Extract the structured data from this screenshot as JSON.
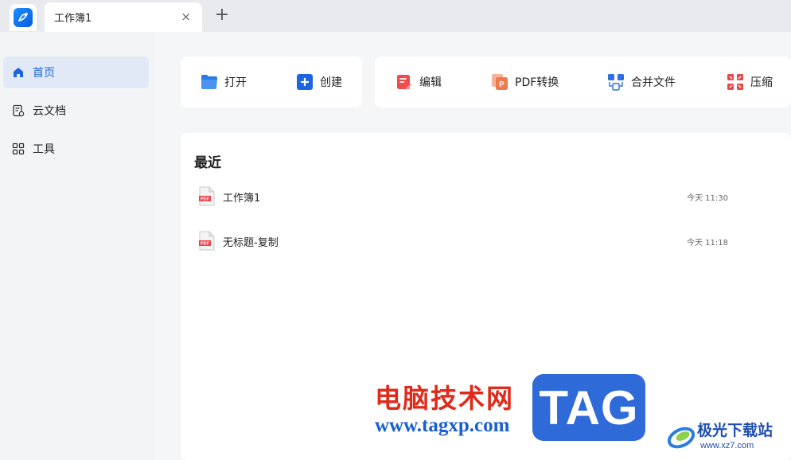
{
  "tabbar": {
    "tab_title": "工作簿1",
    "close_symbol": "×",
    "new_tab_symbol": "+"
  },
  "sidebar": {
    "items": [
      {
        "label": "首页",
        "icon": "home-icon",
        "active": true
      },
      {
        "label": "云文档",
        "icon": "cloud-doc-icon",
        "active": false
      },
      {
        "label": "工具",
        "icon": "tools-grid-icon",
        "active": false
      }
    ]
  },
  "toolbar": {
    "open_label": "打开",
    "create_label": "创建",
    "edit_label": "编辑",
    "pdf_convert_label": "PDF转换",
    "merge_label": "合并文件",
    "compress_label": "压缩"
  },
  "recent": {
    "title": "最近",
    "files": [
      {
        "name": "工作簿1",
        "time": "今天 11:30",
        "icon": "pdf-file-icon"
      },
      {
        "name": "无标题-复制",
        "time": "今天 11:18",
        "icon": "pdf-file-icon"
      }
    ]
  },
  "watermark": {
    "cn_text": "电脑技术网",
    "url": "www.tagxp.com",
    "tag": "TAG",
    "site_name": "极光下载站",
    "site_url": "www.xz7.com"
  },
  "colors": {
    "accent": "#1d64e0",
    "sidebar_active_bg": "#e2e9f6",
    "edit_red": "#f04c4c",
    "pdf_orange": "#f07a4a",
    "merge_blue": "#2f6fe0",
    "compress_red": "#e8474b"
  }
}
